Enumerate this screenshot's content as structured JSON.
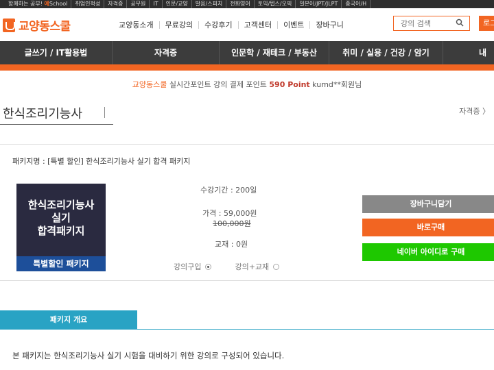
{
  "topbar": {
    "items": [
      "함께하는 공부!",
      "취업인적성",
      "자격증",
      "공무원",
      "IT",
      "인문/교양",
      "발음/스피치",
      "전화영어",
      "토익/텝스/오픽",
      "일본어/JPT/JLPT",
      "중국어/H"
    ],
    "school_label": "School",
    "school_mark": "에"
  },
  "header": {
    "logo": "교양동스쿨",
    "gnb": [
      "교양동소개",
      "무료강의",
      "수강후기",
      "고객센터",
      "이벤트",
      "장바구니"
    ],
    "search_placeholder": "강의 검색",
    "login": "로그인"
  },
  "catnav": [
    "글쓰기 / IT활용법",
    "자격증",
    "인문학 / 재테크 / 부동산",
    "취미 / 실용 / 건강 / 암기",
    "내 강"
  ],
  "ticker": {
    "brand": "교양동스쿨",
    "text1": " 실시간포인트 강의 결제 포인트 ",
    "point": "590 Point",
    "text2": " kumd**회원님"
  },
  "page": {
    "title": "한식조리기능사",
    "category_link": "자격증 〉"
  },
  "package": {
    "name": "패키지명 : [특별 할인] 한식조리기능사 실기 합격 패키지",
    "thumb_line1": "한식조리기능사",
    "thumb_line2": "실기",
    "thumb_line3": "합격패키지",
    "thumb_badge": "특별할인 패키지",
    "period": "수강기간 : 200일",
    "price": "가격 : 59,000원",
    "original_price": "100,000원",
    "textbook": "교재 : 0원",
    "option1": "강의구입",
    "option2": "강의+교재",
    "btn_cart": "장바구니담기",
    "btn_buy": "바로구매",
    "btn_naver": "네이버 아이디로 구매"
  },
  "overview": {
    "tab": "패키지 개요",
    "text": "본 패키지는 한식조리기능사 실기 시험을 대비하기 위한 강의로 구성되어 있습니다."
  },
  "colors": {
    "accent": "#f26522",
    "nav_bg": "#3c3c3c",
    "naver": "#1ec800",
    "overview_tab": "#29a3c4"
  }
}
